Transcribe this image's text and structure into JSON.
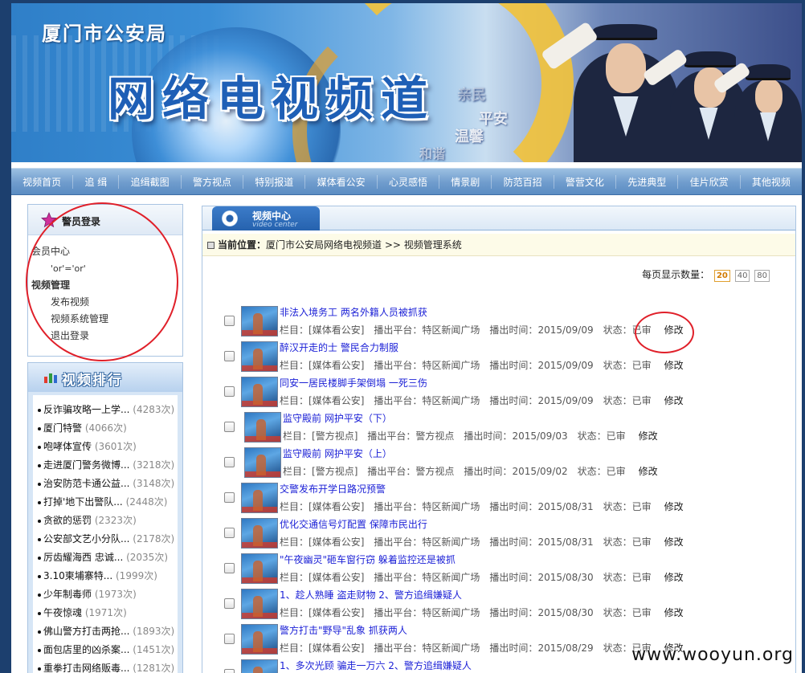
{
  "banner": {
    "bureau": "厦门市公安局",
    "channel": "网络电视频道",
    "words": [
      "亲民",
      "平安",
      "温馨",
      "和谐"
    ]
  },
  "nav": [
    "视频首页",
    "追 缉",
    "追缉截图",
    "警方视点",
    "特别报道",
    "媒体看公安",
    "心灵感悟",
    "情景剧",
    "防范百招",
    "警营文化",
    "先进典型",
    "佳片欣赏",
    "其他视频"
  ],
  "login": {
    "title": "警员登录",
    "member_center": "会员中心",
    "user": "'or'='or'",
    "video_mgmt": "视频管理",
    "publish": "发布视频",
    "system_mgmt": "视频系统管理",
    "logout": "退出登录"
  },
  "ranking": {
    "title": "视频排行",
    "items": [
      {
        "t": "反诈骗攻略一上学...",
        "c": "(4283次)"
      },
      {
        "t": "厦门特警",
        "c": "(4066次)"
      },
      {
        "t": "咆哮体宣传",
        "c": "(3601次)"
      },
      {
        "t": "走进厦门警务微博...",
        "c": "(3218次)"
      },
      {
        "t": "治安防范卡通公益...",
        "c": "(3148次)"
      },
      {
        "t": "打掉'地下出警队...",
        "c": "(2448次)"
      },
      {
        "t": "贪欲的惩罚",
        "c": "(2323次)"
      },
      {
        "t": "公安部文艺小分队...",
        "c": "(2178次)"
      },
      {
        "t": "厉齿耀海西 忠诚...",
        "c": "(2035次)"
      },
      {
        "t": "3.10柬埔寨特...",
        "c": "(1999次)"
      },
      {
        "t": "少年制毒师",
        "c": "(1973次)"
      },
      {
        "t": "午夜惊魂",
        "c": "(1971次)"
      },
      {
        "t": "佛山警方打击两抢...",
        "c": "(1893次)"
      },
      {
        "t": "面包店里的凶杀案...",
        "c": "(1451次)"
      },
      {
        "t": "重拳打击网络贩毒...",
        "c": "(1281次)"
      }
    ]
  },
  "main": {
    "tab_title": "视频中心",
    "tab_sub": "video center",
    "location_label": "当前位置：",
    "location_path": "厦门市公安局网络电视频道 >> 视频管理系统",
    "per_page_label": "每页显示数量：",
    "per_page_options": [
      "20",
      "40",
      "80"
    ],
    "meta_labels": {
      "column": "栏目：",
      "platform": "播出平台：",
      "time": "播出时间：",
      "status": "状态：",
      "edit": "修改"
    },
    "videos": [
      {
        "title": "非法入境务工 两名外籍人员被抓获",
        "column": "[媒体看公安]",
        "platform": "特区新闻广场",
        "date": "2015/09/09",
        "status": "已审"
      },
      {
        "title": "醉汉开走的士 警民合力制服",
        "column": "[媒体看公安]",
        "platform": "特区新闻广场",
        "date": "2015/09/09",
        "status": "已审"
      },
      {
        "title": "同安一居民楼脚手架倒塌 一死三伤",
        "column": "[媒体看公安]",
        "platform": "特区新闻广场",
        "date": "2015/09/09",
        "status": "已审"
      },
      {
        "title": "监守殿前 网护平安（下）",
        "column": "[警方视点]",
        "platform": "警方视点",
        "date": "2015/09/03",
        "status": "已审"
      },
      {
        "title": "监守殿前 网护平安（上）",
        "column": "[警方视点]",
        "platform": "警方视点",
        "date": "2015/09/02",
        "status": "已审"
      },
      {
        "title": "交警发布开学日路况预警",
        "column": "[媒体看公安]",
        "platform": "特区新闻广场",
        "date": "2015/08/31",
        "status": "已审"
      },
      {
        "title": "优化交通信号灯配置 保障市民出行",
        "column": "[媒体看公安]",
        "platform": "特区新闻广场",
        "date": "2015/08/31",
        "status": "已审"
      },
      {
        "title": "\"午夜幽灵\"砸车窗行窃 躲着监控还是被抓",
        "column": "[媒体看公安]",
        "platform": "特区新闻广场",
        "date": "2015/08/30",
        "status": "已审"
      },
      {
        "title": "1、趁人熟睡 盗走财物 2、警方追缉嫌疑人",
        "column": "[媒体看公安]",
        "platform": "特区新闻广场",
        "date": "2015/08/30",
        "status": "已审"
      },
      {
        "title": "警方打击\"野导\"乱象 抓获两人",
        "column": "[媒体看公安]",
        "platform": "特区新闻广场",
        "date": "2015/08/29",
        "status": "已审"
      },
      {
        "title": "1、多次光顾 骗走一万六 2、警方追缉嫌疑人",
        "column": "",
        "platform": "",
        "date": "",
        "status": ""
      }
    ]
  },
  "watermark": "www.wooyun.org"
}
